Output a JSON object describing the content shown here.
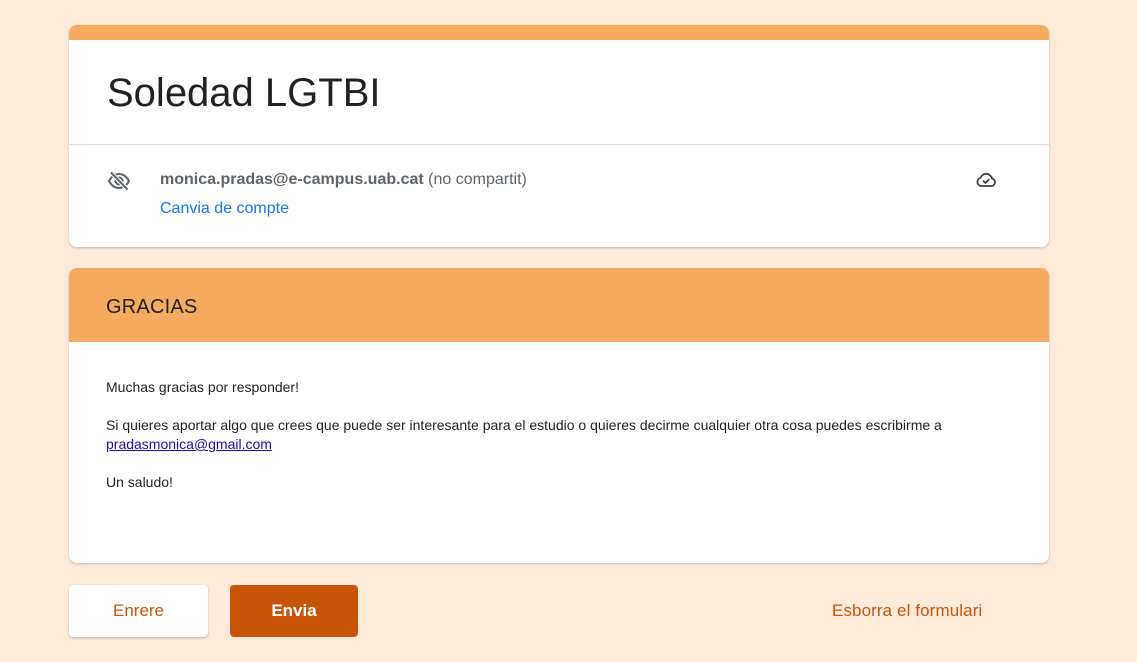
{
  "form": {
    "title": "Soledad LGTBI",
    "account": {
      "email": "monica.pradas@e-campus.uab.cat",
      "shared_status": "(no compartit)",
      "switch_label": "Canvia de compte",
      "visibility_icon": "eye-off-icon",
      "save_icon": "cloud-check-icon"
    }
  },
  "section": {
    "title": "GRACIAS",
    "paragraph1": "Muchas gracias por responder!",
    "paragraph2_text": "Si quieres aportar algo que crees que puede ser interesante para el estudio o quieres decirme cualquier otra cosa puedes escribirme a ",
    "paragraph2_link": "pradasmonica@gmail.com",
    "paragraph3": "Un saludo!"
  },
  "actions": {
    "back_label": "Enrere",
    "submit_label": "Envia",
    "clear_label": "Esborra el formulari"
  },
  "colors": {
    "background": "#fdeadb",
    "accent": "#f6ac60",
    "primary_button": "#c75509",
    "link": "#1a73e8"
  }
}
